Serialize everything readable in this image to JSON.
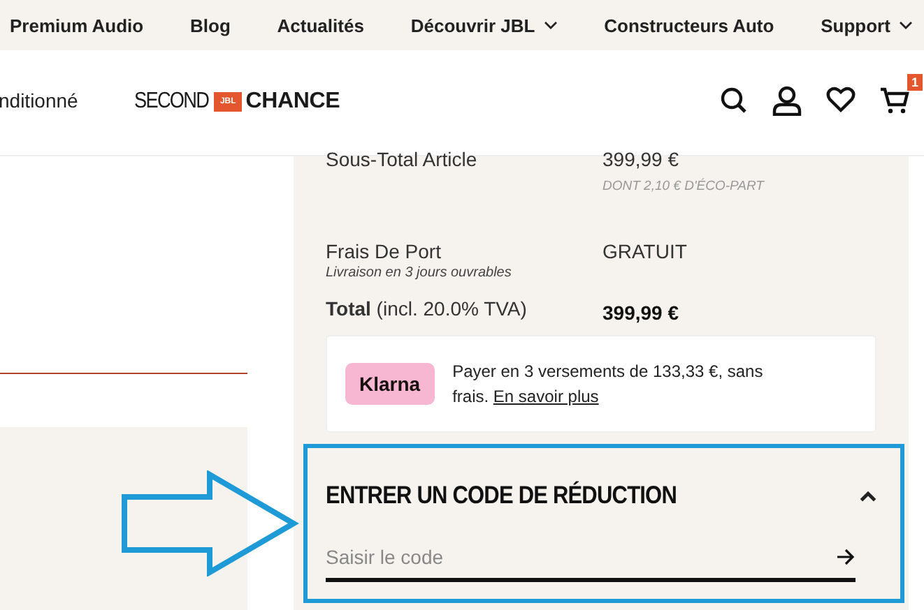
{
  "top_nav": {
    "items": [
      {
        "label": "Premium Audio",
        "dropdown": false
      },
      {
        "label": "Blog",
        "dropdown": false
      },
      {
        "label": "Actualités",
        "dropdown": false
      },
      {
        "label": "Découvrir JBL",
        "dropdown": true
      },
      {
        "label": "Constructeurs Auto",
        "dropdown": false
      },
      {
        "label": "Support",
        "dropdown": true
      }
    ]
  },
  "header": {
    "nav_fragment": "nditionné",
    "logo": {
      "left": "SECOND",
      "badge": "JBL",
      "right": "CHANCE"
    },
    "cart_count": "1"
  },
  "summary": {
    "rows": [
      {
        "label": "Sous-Total Article",
        "value": "399,99 €",
        "note": "DONT 2,10 € D'ÉCO-PART",
        "kind": "subtotal"
      },
      {
        "label": "Frais De Port",
        "sublabel": "Livraison en 3 jours ouvrables",
        "value": "GRATUIT",
        "kind": "shipping"
      },
      {
        "label": "**Total** (incl. 20.0% TVA)",
        "value": "399,99 €",
        "kind": "total"
      }
    ]
  },
  "klarna": {
    "badge": "Klarna",
    "text": "Payer en 3 versements de 133,33 €, sans frais.",
    "link": "En savoir plus"
  },
  "discount": {
    "title": "ENTRER UN CODE DE RÉDUCTION",
    "expanded": true,
    "placeholder": "Saisir le code"
  }
}
